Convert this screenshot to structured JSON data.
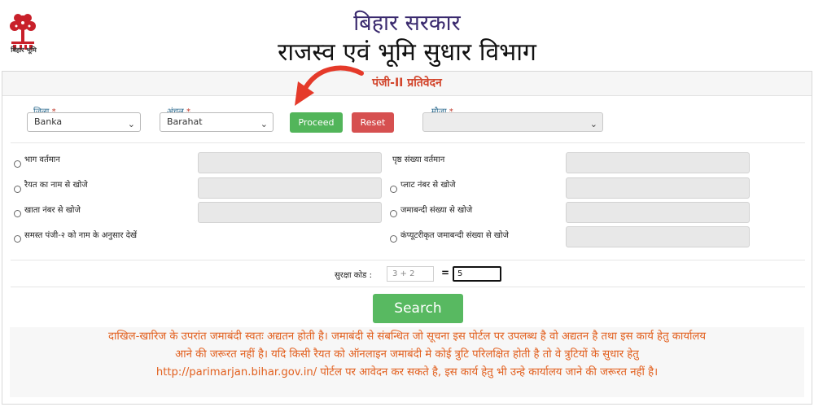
{
  "header": {
    "logo_caption": "बिहार भूमि",
    "title_line1": "बिहार सरकार",
    "title_line2": "राजस्व एवं भूमि सुधार विभाग"
  },
  "panel": {
    "heading": "पंजी-II प्रतिवेदन"
  },
  "filters": {
    "district_label": "जिला",
    "district_value": "Banka",
    "circle_label": "अंचल",
    "circle_value": "Barahat",
    "mauja_label": "मौजा",
    "mauja_value": "",
    "required_mark": "*",
    "proceed_label": "Proceed",
    "reset_label": "Reset"
  },
  "search_options": {
    "left": [
      "भाग वर्तमान",
      "रैयत का नाम से खोजे",
      "खाता नंबर से खोजे",
      "समस्त पंजी-२ को नाम के अनुसार देखें"
    ],
    "right": [
      "पृष्ठ संख्या वर्तमान",
      "प्लाट नंबर से खोजे",
      "जमाबन्दी संख्या से खोजे",
      "कंप्यूटरीकृत जमाबन्दी संख्या से खोजे"
    ]
  },
  "captcha": {
    "label": "सुरक्षा कोड :",
    "question": "3 + 2",
    "equals": "=",
    "answer": "5"
  },
  "search_button_label": "Search",
  "notice": {
    "line1": "दाखिल-खारिज के उपरांत जमाबंदी स्वतः अद्यतन होती है। जमाबंदी से संबन्धित जो सूचना इस पोर्टल पर उपलब्ध है वो अद्यतन है तथा इस कार्य हेतु कार्यालय",
    "line2": "आने की जरूरत नहीं है। यदि किसी रैयत को ऑनलाइन जमाबंदी मे कोई त्रुटि परिलक्षित होती है तो वे त्रुटियों के सुधार हेतु",
    "line3": "http://parimarjan.bihar.gov.in/ पोर्टल पर आवेदन कर सकते है, इस कार्य हेतु भी उन्हे कार्यालय जाने की जरूरत नहीं है।"
  },
  "colors": {
    "heading": "#d2452c",
    "notice_text": "#e2601f",
    "proceed": "#52b55a",
    "reset": "#d65050",
    "annotation_arrow": "#e53a2a"
  },
  "icons": {
    "logo": "bodhi-tree-logo-icon",
    "select_chevron": "chevron-down-icon",
    "annotation": "curved-arrow-icon"
  }
}
